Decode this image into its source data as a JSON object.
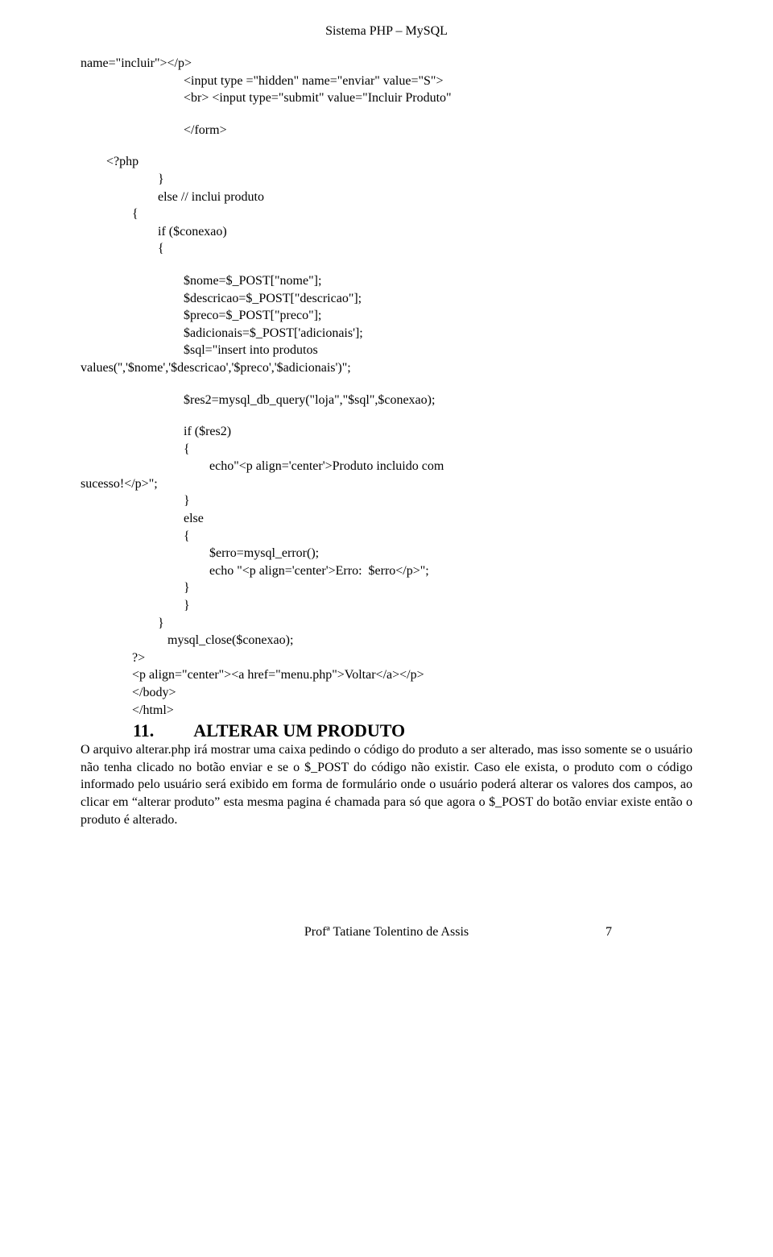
{
  "header": "Sistema PHP – MySQL",
  "code": {
    "c01": "name=\"incluir\"></p>",
    "c02": "<input type =\"hidden\" name=\"enviar\" value=\"S\">",
    "c03": "<br> <input type=\"submit\" value=\"Incluir Produto\"",
    "c04": "</form>",
    "c05": "<?php",
    "c06": "}",
    "c07": "else // inclui produto",
    "c08": "{",
    "c09": "if ($conexao)",
    "c10": "{",
    "c11": "$nome=$_POST[\"nome\"];",
    "c12": "$descricao=$_POST[\"descricao\"];",
    "c13": "$preco=$_POST[\"preco\"];",
    "c14": "$adicionais=$_POST['adicionais'];",
    "c15": "$sql=\"insert into produtos",
    "c16": "values('','$nome','$descricao','$preco','$adicionais')\";",
    "c17": "$res2=mysql_db_query(\"loja\",\"$sql\",$conexao);",
    "c18": "if ($res2)",
    "c19": "{",
    "c20": "echo\"<p align='center'>Produto incluido com",
    "c21": "sucesso!</p>\";",
    "c22": "}",
    "c23": "else",
    "c24": "{",
    "c25": "$erro=mysql_error();",
    "c26": "echo \"<p align='center'>Erro:  $erro</p>\";",
    "c27": "}",
    "c28": "}",
    "c29": "}",
    "c30": "mysql_close($conexao);",
    "c31": "?>",
    "c32": "<p align=\"center\"><a href=\"menu.php\">Voltar</a></p>",
    "c33": "</body>",
    "c34": "</html>"
  },
  "section": {
    "num": "11.",
    "title": "ALTERAR UM PRODUTO"
  },
  "body_paragraph": "O arquivo alterar.php irá mostrar uma caixa pedindo o código do produto a ser alterado, mas isso somente se o usuário não tenha clicado no botão enviar e se o $_POST do código não existir. Caso ele exista, o produto com o código informado pelo usuário será exibido em forma de formulário onde o usuário poderá alterar os valores dos campos, ao clicar em “alterar produto” esta mesma pagina é chamada para só que agora o $_POST do botão enviar existe então o produto é alterado.",
  "footer": {
    "author": "Profª Tatiane Tolentino de Assis",
    "page": "7"
  }
}
